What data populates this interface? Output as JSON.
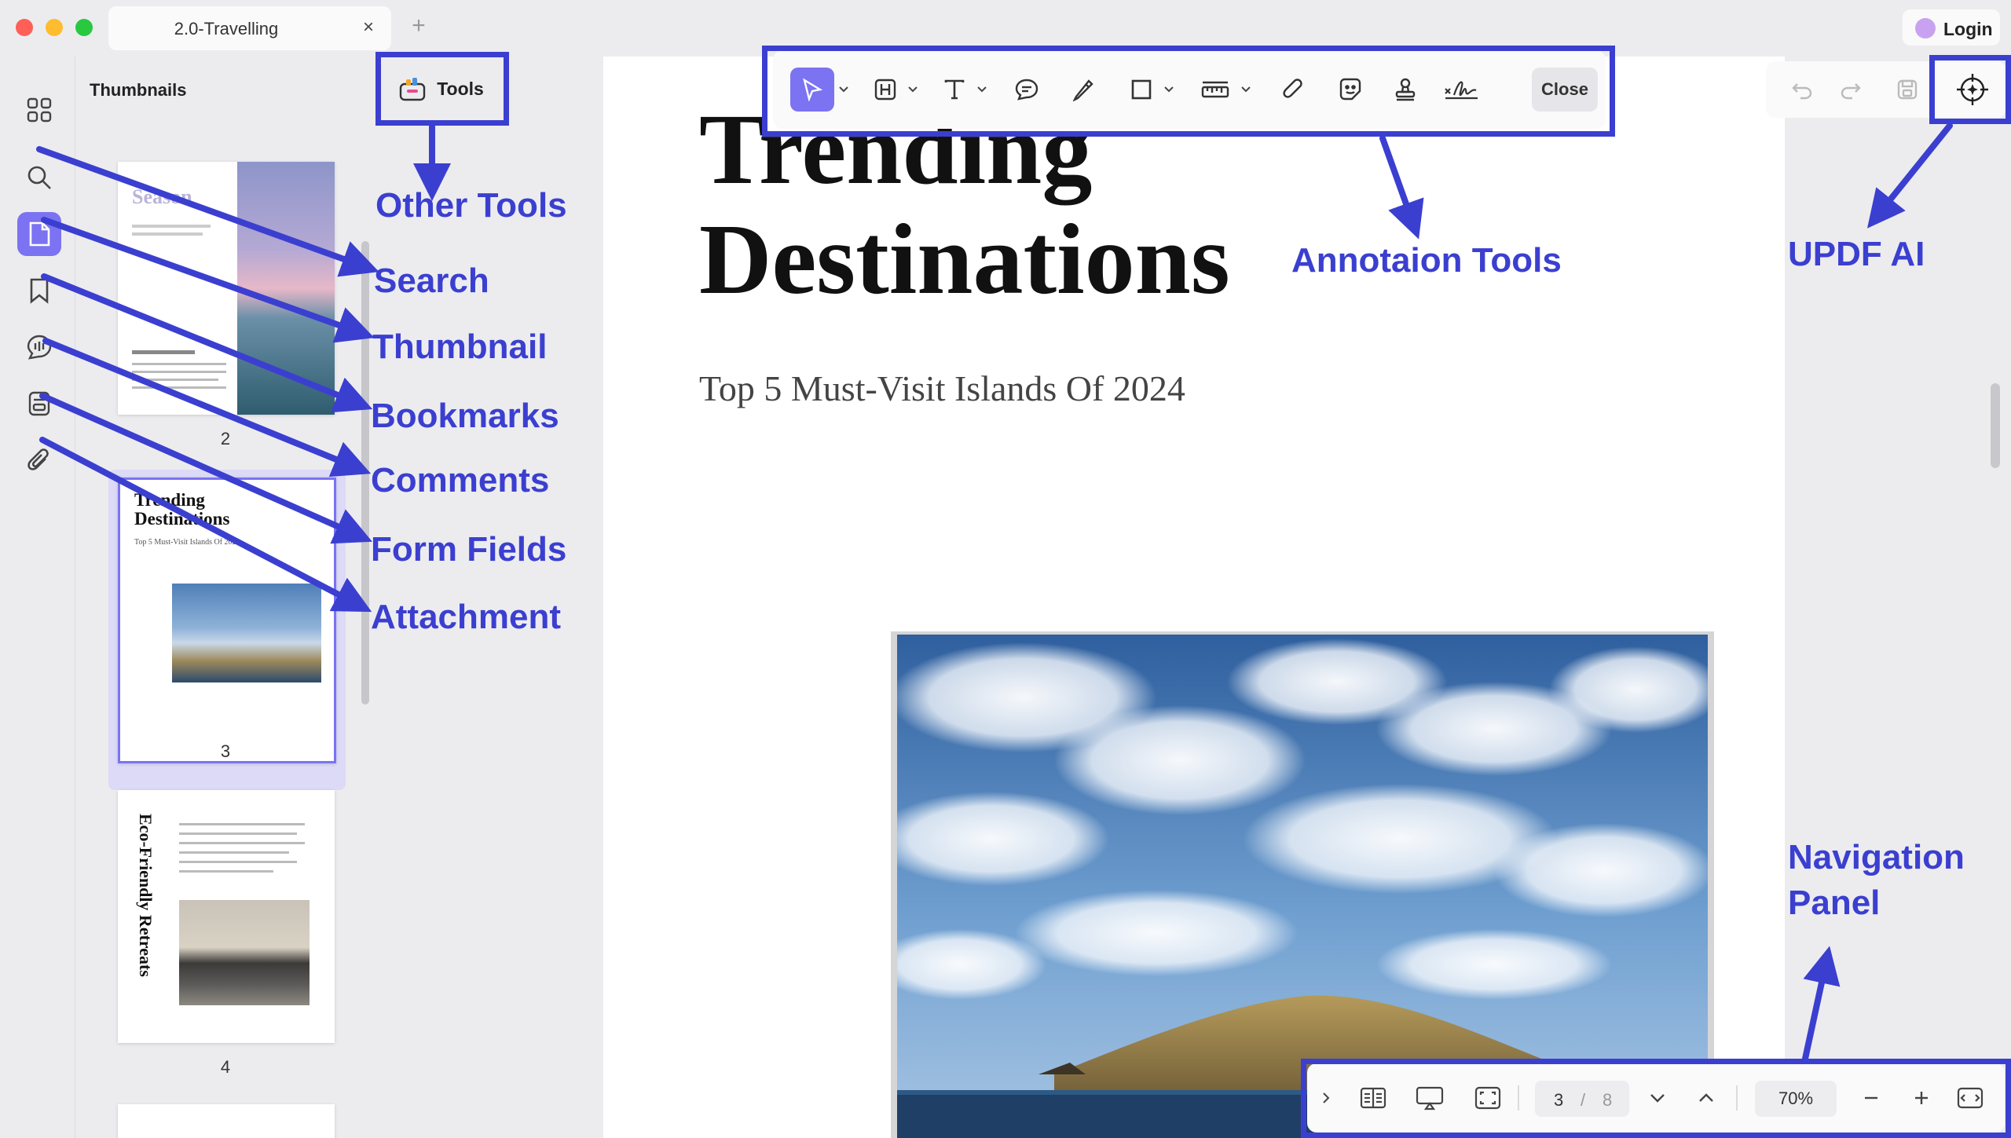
{
  "window": {
    "tab_title": "2.0-Travelling",
    "tab_close": "×",
    "new_tab": "+",
    "login_label": "Login"
  },
  "colors": {
    "accent": "#7b73f2",
    "annotation": "#3b3fd0",
    "traffic_red": "#fe5f57",
    "traffic_yellow": "#febc2e",
    "traffic_green": "#28c840"
  },
  "rail": {
    "items": [
      {
        "name": "grid-icon",
        "active": false
      },
      {
        "name": "search-icon",
        "active": false
      },
      {
        "name": "thumbnail-icon",
        "active": true
      },
      {
        "name": "bookmark-icon",
        "active": false
      },
      {
        "name": "comment-icon",
        "active": false
      },
      {
        "name": "form-field-icon",
        "active": false
      },
      {
        "name": "attachment-icon",
        "active": false
      }
    ]
  },
  "thumbnails": {
    "title": "Thumbnails",
    "pages": [
      {
        "number": "2",
        "heading": "Season"
      },
      {
        "number": "3",
        "heading": "Trending Destinations",
        "subheading": "Top 5 Must-Visit Islands Of 2024",
        "selected": true
      },
      {
        "number": "4",
        "heading": "Eco-Friendly Retreats"
      }
    ]
  },
  "tools": {
    "label": "Tools"
  },
  "annotation_toolbar": {
    "tools": [
      "select-icon",
      "highlight-icon",
      "text-icon",
      "note-icon",
      "pencil-icon",
      "shape-icon",
      "measure-icon",
      "attach-icon",
      "sticker-icon",
      "stamp-icon",
      "signature-icon"
    ],
    "close_label": "Close"
  },
  "right_toolbar": {
    "icons": [
      "undo-icon",
      "redo-icon",
      "save-icon",
      "ai-assistant-icon"
    ]
  },
  "document": {
    "title_line1": "Trending",
    "title_line2": "Destinations",
    "subtitle": "Top 5 Must-Visit Islands Of 2024"
  },
  "navigation": {
    "current_page": "3",
    "separator": "/",
    "total_pages": "8",
    "zoom": "70%"
  },
  "annotations": {
    "other_tools": "Other Tools",
    "search": "Search",
    "thumbnail": "Thumbnail",
    "bookmarks": "Bookmarks",
    "comments": "Comments",
    "form_fields": "Form Fields",
    "attachment": "Attachment",
    "annotation_tools": "Annotaion Tools",
    "updf_ai": "UPDF AI",
    "navigation_panel_line1": "Navigation",
    "navigation_panel_line2": "Panel"
  }
}
